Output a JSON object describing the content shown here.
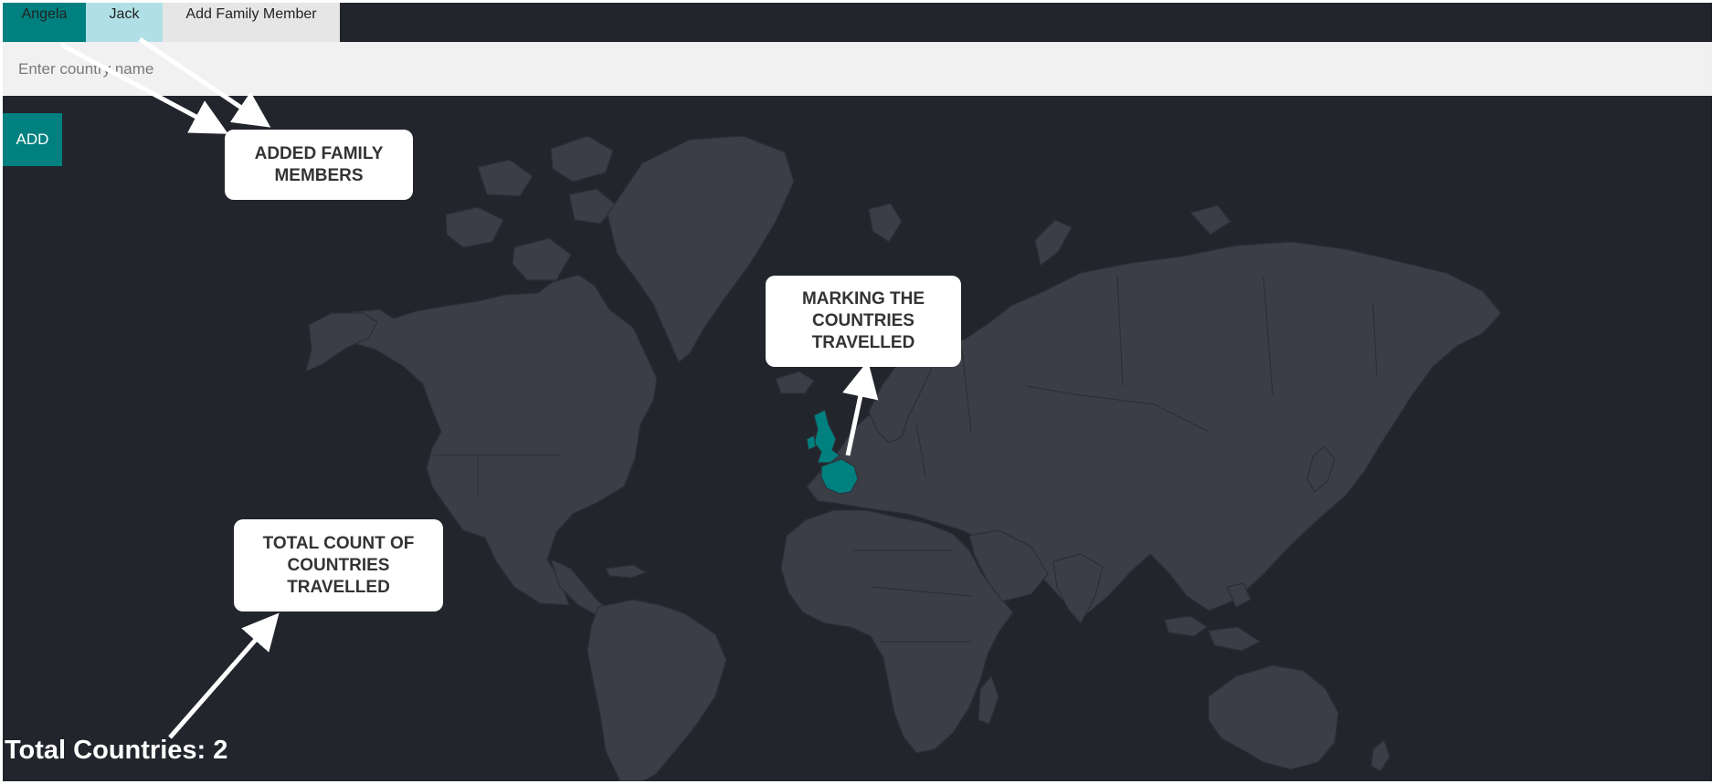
{
  "tabs": [
    {
      "label": "Angela"
    },
    {
      "label": "Jack"
    },
    {
      "label": "Add Family Member"
    }
  ],
  "search": {
    "placeholder": "Enter country name",
    "value": ""
  },
  "add_button_label": "ADD",
  "callouts": {
    "family": "ADDED FAMILY MEMBERS",
    "marking": "MARKING THE COUNTRIES TRAVELLED",
    "total": "TOTAL COUNT OF COUNTRIES TRAVELLED"
  },
  "total": {
    "label": "Total Countries: 2"
  },
  "map": {
    "visited_countries": [
      "United Kingdom",
      "France"
    ],
    "visited_count": 2
  },
  "colors": {
    "background": "#22252c",
    "land": "#3b3e47",
    "accent": "#00807f",
    "selected_tab": "#00807f",
    "tab_jack": "#b0e0e6",
    "tab_add": "#e6e6e6",
    "input_background": "#f1f1f1"
  }
}
